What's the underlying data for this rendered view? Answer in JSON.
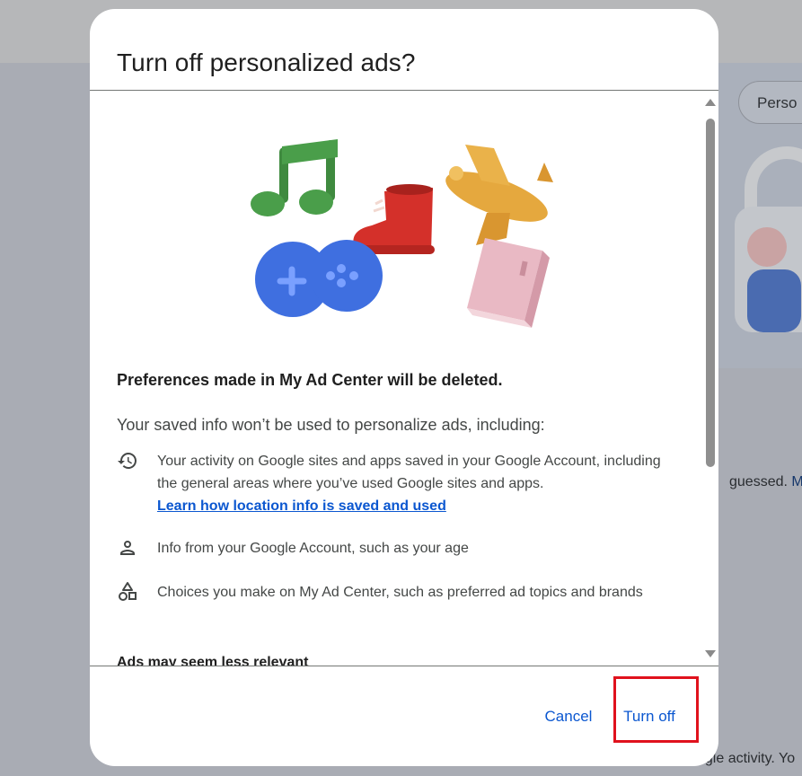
{
  "background": {
    "chip_label": "Perso",
    "right_text": "guessed.",
    "right_link": "Ma",
    "bottom_text": "ogle activity. Yo"
  },
  "dialog": {
    "title": "Turn off personalized ads?",
    "heading": "Preferences made in My Ad Center will be deleted.",
    "intro": "Your saved info won’t be used to personalize ads, including:",
    "items": [
      {
        "icon": "history-icon",
        "text": "Your activity on Google sites and apps saved in your Google Account, including the general areas where you’ve used Google sites and apps.",
        "link": "Learn how location info is saved and used"
      },
      {
        "icon": "person-icon",
        "text": "Info from your Google Account, such as your age"
      },
      {
        "icon": "shapes-icon",
        "text": "Choices you make on My Ad Center, such as preferred ad topics and brands"
      }
    ],
    "cutoff_heading": "Ads may seem less relevant",
    "cancel_label": "Cancel",
    "turn_off_label": "Turn off"
  },
  "colors": {
    "accent": "#0b57d0",
    "highlight": "#e0121d"
  }
}
